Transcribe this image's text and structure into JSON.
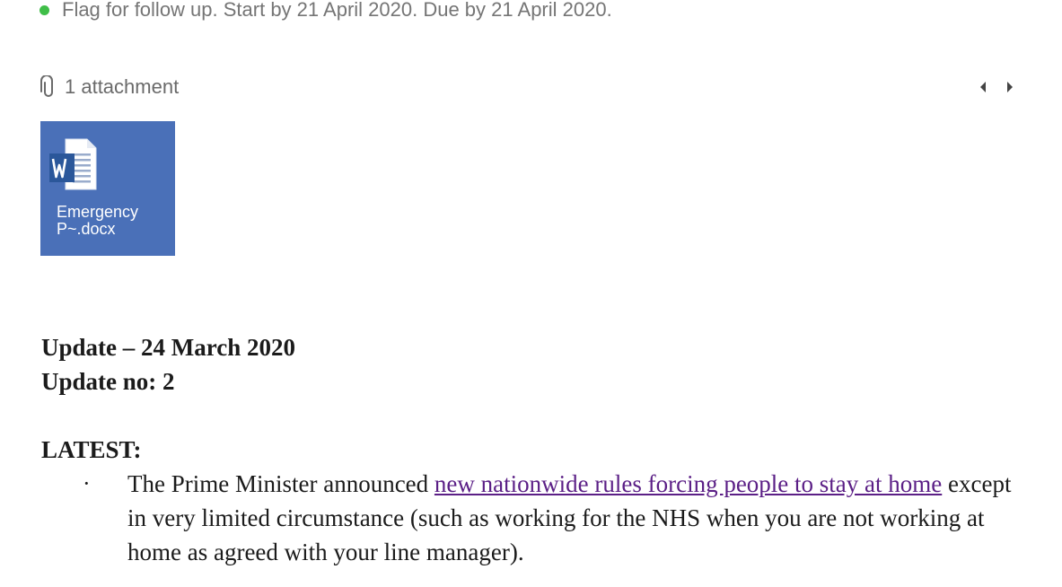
{
  "flag": {
    "text": "Flag for follow up. Start by 21 April 2020. Due by 21 April 2020.",
    "dot_color": "#3fbe48"
  },
  "attachments": {
    "count_label": "1 attachment",
    "icon": "paperclip-icon",
    "items": [
      {
        "name": "Emergency P~.docx",
        "name_line1": "Emergency",
        "name_line2": "P~.docx",
        "icon": "word-document-icon",
        "tile_color": "#4a70b8"
      }
    ],
    "nav": {
      "prev_icon": "chevron-left-icon",
      "next_icon": "chevron-right-icon"
    }
  },
  "message": {
    "update_line": "Update – 24 March 2020",
    "update_no": "Update no: 2",
    "latest_heading": "LATEST:",
    "bullets": [
      {
        "marker": "·",
        "text_before": "The Prime Minister announced ",
        "link_text": "new nationwide rules forcing people to stay at home",
        "text_after": " except in very limited circumstance (such as working for the NHS when you are not working at home as agreed with your line manager).",
        "link_color": "#5b1f86"
      }
    ]
  }
}
